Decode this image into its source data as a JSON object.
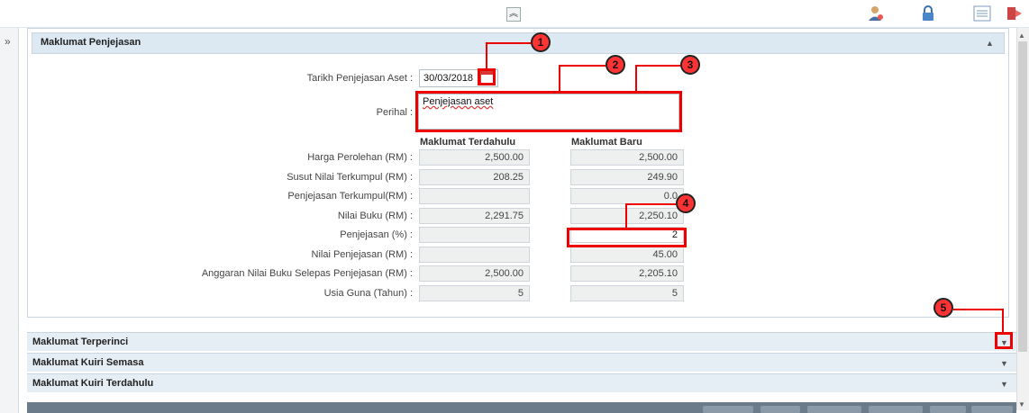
{
  "toolbar": {
    "collapse_glyph": "≈",
    "icons": [
      "user-icon",
      "lock-icon",
      "list-icon",
      "exit-icon"
    ]
  },
  "sidebar": {
    "expand_glyph": "»"
  },
  "panel": {
    "title": "Maklumat Penjejasan",
    "toggle_glyph": "▲",
    "date_label": "Tarikh Penjejasan Aset :",
    "date_value": "30/03/2018",
    "perihal_label": "Perihal :",
    "perihal_value": "Penjejasan aset",
    "col_prev": "Maklumat Terdahulu",
    "col_new": "Maklumat Baru",
    "rows": [
      {
        "label": "Harga Perolehan (RM) :",
        "prev": "2,500.00",
        "new": "2,500.00"
      },
      {
        "label": "Susut Nilai Terkumpul (RM) :",
        "prev": "208.25",
        "new": "249.90"
      },
      {
        "label": "Penjejasan Terkumpul(RM) :",
        "prev": "",
        "new": "0.0"
      },
      {
        "label": "Nilai Buku (RM) :",
        "prev": "2,291.75",
        "new": "2,250.10"
      },
      {
        "label": "Penjejasan (%) :",
        "prev": "",
        "new": "2"
      },
      {
        "label": "Nilai Penjejasan (RM) :",
        "prev": "",
        "new": "45.00"
      },
      {
        "label": "Anggaran Nilai Buku Selepas Penjejasan (RM) :",
        "prev": "2,500.00",
        "new": "2,205.10"
      },
      {
        "label": "Usia Guna (Tahun) :",
        "prev": "5",
        "new": "5"
      }
    ]
  },
  "accordion": [
    {
      "label": "Maklumat Terperinci",
      "caret": "▼"
    },
    {
      "label": "Maklumat Kuiri Semasa",
      "caret": "▼"
    },
    {
      "label": "Maklumat Kuiri Terdahulu",
      "caret": "▼"
    }
  ],
  "callouts": [
    "1",
    "2",
    "3",
    "4",
    "5"
  ],
  "colors": {
    "highlight": "#e00000",
    "badge": "#ff3333",
    "header": "#dce9f3"
  }
}
